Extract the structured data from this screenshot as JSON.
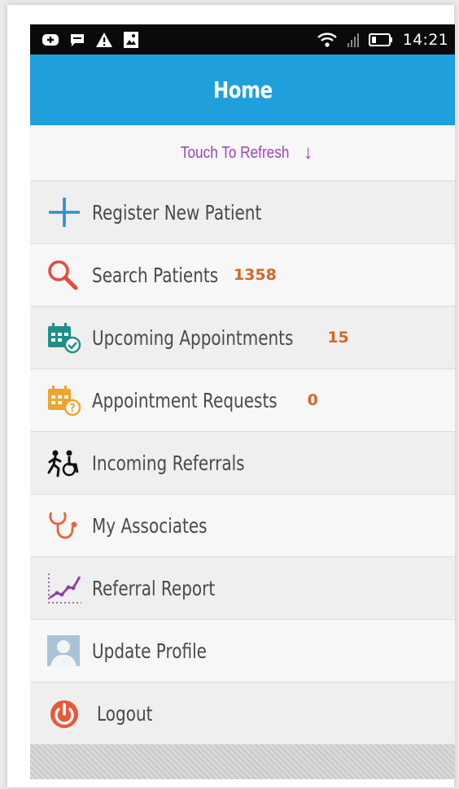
{
  "status_bar": {
    "time": "14:21",
    "left_icons": [
      "plus-square-icon",
      "message-icon",
      "warning-icon",
      "image-icon"
    ],
    "right_icons": [
      "wifi-icon",
      "signal-icon",
      "battery-icon"
    ]
  },
  "app_bar": {
    "title": "Home"
  },
  "refresh": {
    "label": "Touch To Refresh",
    "arrow": "↓"
  },
  "menu": [
    {
      "label": "Register New Patient",
      "icon": "plus-icon",
      "count": ""
    },
    {
      "label": "Search Patients",
      "icon": "search-icon",
      "count": "1358"
    },
    {
      "label": "Upcoming Appointments",
      "icon": "calendar-check-icon",
      "count": "15"
    },
    {
      "label": "Appointment Requests",
      "icon": "calendar-question-icon",
      "count": "0"
    },
    {
      "label": "Incoming Referrals",
      "icon": "referral-people-icon",
      "count": ""
    },
    {
      "label": "My Associates",
      "icon": "stethoscope-icon",
      "count": ""
    },
    {
      "label": "Referral Report",
      "icon": "line-chart-icon",
      "count": ""
    },
    {
      "label": "Update Profile",
      "icon": "profile-avatar-icon",
      "count": ""
    },
    {
      "label": "Logout",
      "icon": "power-icon",
      "count": ""
    }
  ],
  "colors": {
    "app_bar": "#1fa0dc",
    "refresh_text": "#9c47b5",
    "count": "#d4672a",
    "label": "#4a4a4a"
  }
}
